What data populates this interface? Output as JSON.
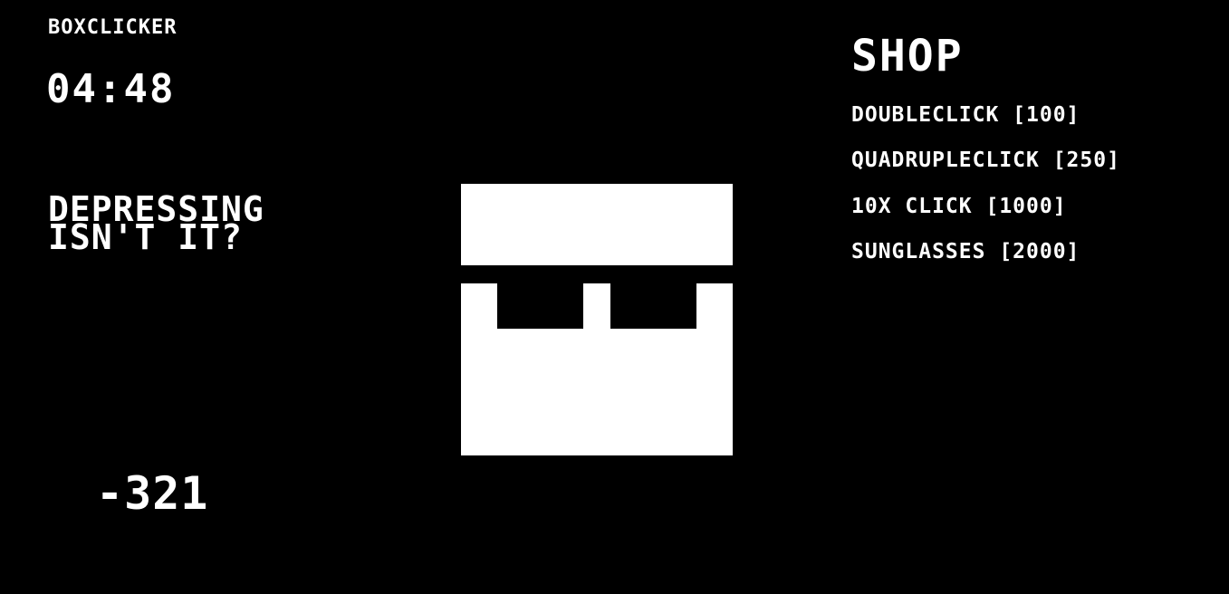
{
  "app": {
    "title": "BOXCLICKER",
    "timer": "04:48",
    "message_line1": "DEPRESSING",
    "message_line2": "ISN'T IT?",
    "score": "-321"
  },
  "box": {
    "description_icon": "box-face-icon"
  },
  "shop": {
    "title": "SHOP",
    "items": [
      {
        "label": "DOUBLECLICK [100]"
      },
      {
        "label": "QUADRUPLECLICK [250]"
      },
      {
        "label": "10X CLICK [1000]"
      },
      {
        "label": "SUNGLASSES [2000]"
      }
    ]
  },
  "colors": {
    "background": "#000000",
    "foreground": "#ffffff"
  }
}
